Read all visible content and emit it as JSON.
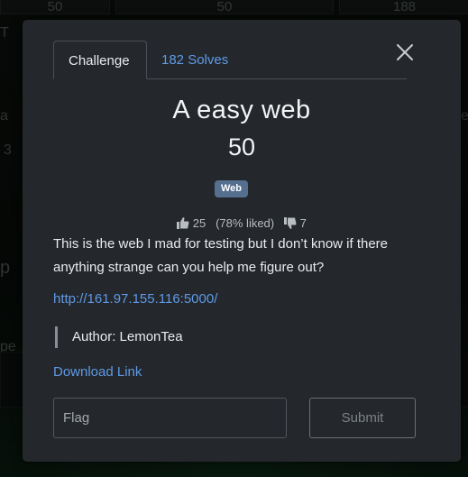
{
  "background": {
    "tiles": [
      "50",
      "50",
      "188"
    ],
    "side_left": [
      "T",
      "a",
      "3",
      "p",
      "pe",
      "nk"
    ],
    "side_right": [
      "e"
    ]
  },
  "modal": {
    "tabs": [
      {
        "label": "Challenge",
        "active": true
      },
      {
        "label": "182 Solves",
        "active": false
      }
    ],
    "close_icon": "close-icon",
    "title": "A easy web",
    "points": "50",
    "category_badge": "Web",
    "rating": {
      "likes": "25",
      "percent_text": "(78% liked)",
      "dislikes": "7"
    },
    "description": "This is the web I mad for testing but I don’t know if there anything strange can you help me figure out?",
    "url": "http://161.97.155.116:5000/",
    "author": "Author: LemonTea",
    "download_label": "Download Link",
    "flag_placeholder": "Flag",
    "submit_label": "Submit"
  },
  "colors": {
    "modal_bg": "#24272b",
    "link": "#5e9ae6",
    "badge": "#55708f"
  }
}
